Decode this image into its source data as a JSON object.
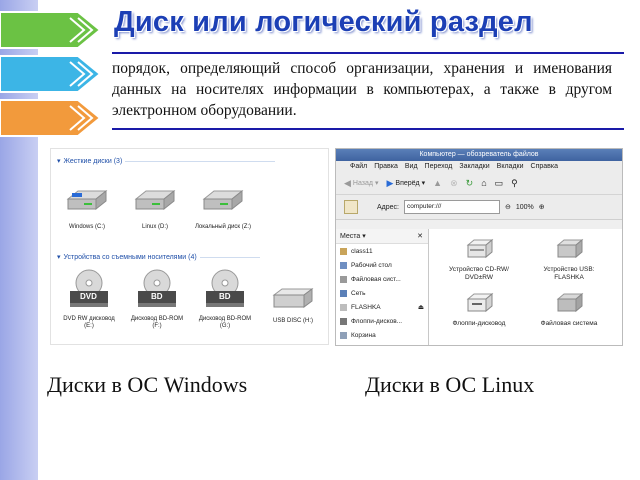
{
  "slide": {
    "title": "Диск или логический раздел",
    "description": "порядок, определяющий способ организации, хранения и именования данных на носителях информации в компьютерах, а также в другом электронном оборудовании.",
    "caption_windows": "Диски в ОС Windows",
    "caption_linux": "Диски в ОС Linux"
  },
  "windows_explorer": {
    "hard_drives_header": "Жесткие диски (3)",
    "hard_drives": [
      {
        "label": "Windows (C:)"
      },
      {
        "label": "Linux (D:)"
      },
      {
        "label": "Локальный диск (Z:)"
      }
    ],
    "removable_header": "Устройства со съемными носителями (4)",
    "removable": [
      {
        "label": "DVD RW дисковод (E:)",
        "badge": "DVD"
      },
      {
        "label": "Дисковод BD-ROM (F:)",
        "badge": "BD"
      },
      {
        "label": "Дисковод BD-ROM (G:)",
        "badge": "BD"
      },
      {
        "label": "USB DISC (H:)",
        "badge": ""
      }
    ]
  },
  "linux_nautilus": {
    "window_title": "Компьютер — обозреватель файлов",
    "menu": [
      "Файл",
      "Правка",
      "Вид",
      "Переход",
      "Закладки",
      "Вкладки",
      "Справка"
    ],
    "toolbar": {
      "back": "Назад",
      "forward": "Вперёд"
    },
    "address_label": "Адрес:",
    "address_value": "computer:///",
    "zoom": "100%",
    "places_label": "Места",
    "places": [
      "class11",
      "Рабочий стол",
      "Файловая сист...",
      "Сеть",
      "FLASHKA",
      "Флоппи-дисков...",
      "Корзина"
    ],
    "items": [
      "Устройство CD-RW/ DVD±RW",
      "Устройство USB: FLASHKA",
      "Флоппи-дисковод",
      "Файловая система"
    ]
  },
  "colors": {
    "title": "#1c3fb5",
    "rule": "#1a1aa8",
    "sidebar": "#a9b3ea"
  }
}
